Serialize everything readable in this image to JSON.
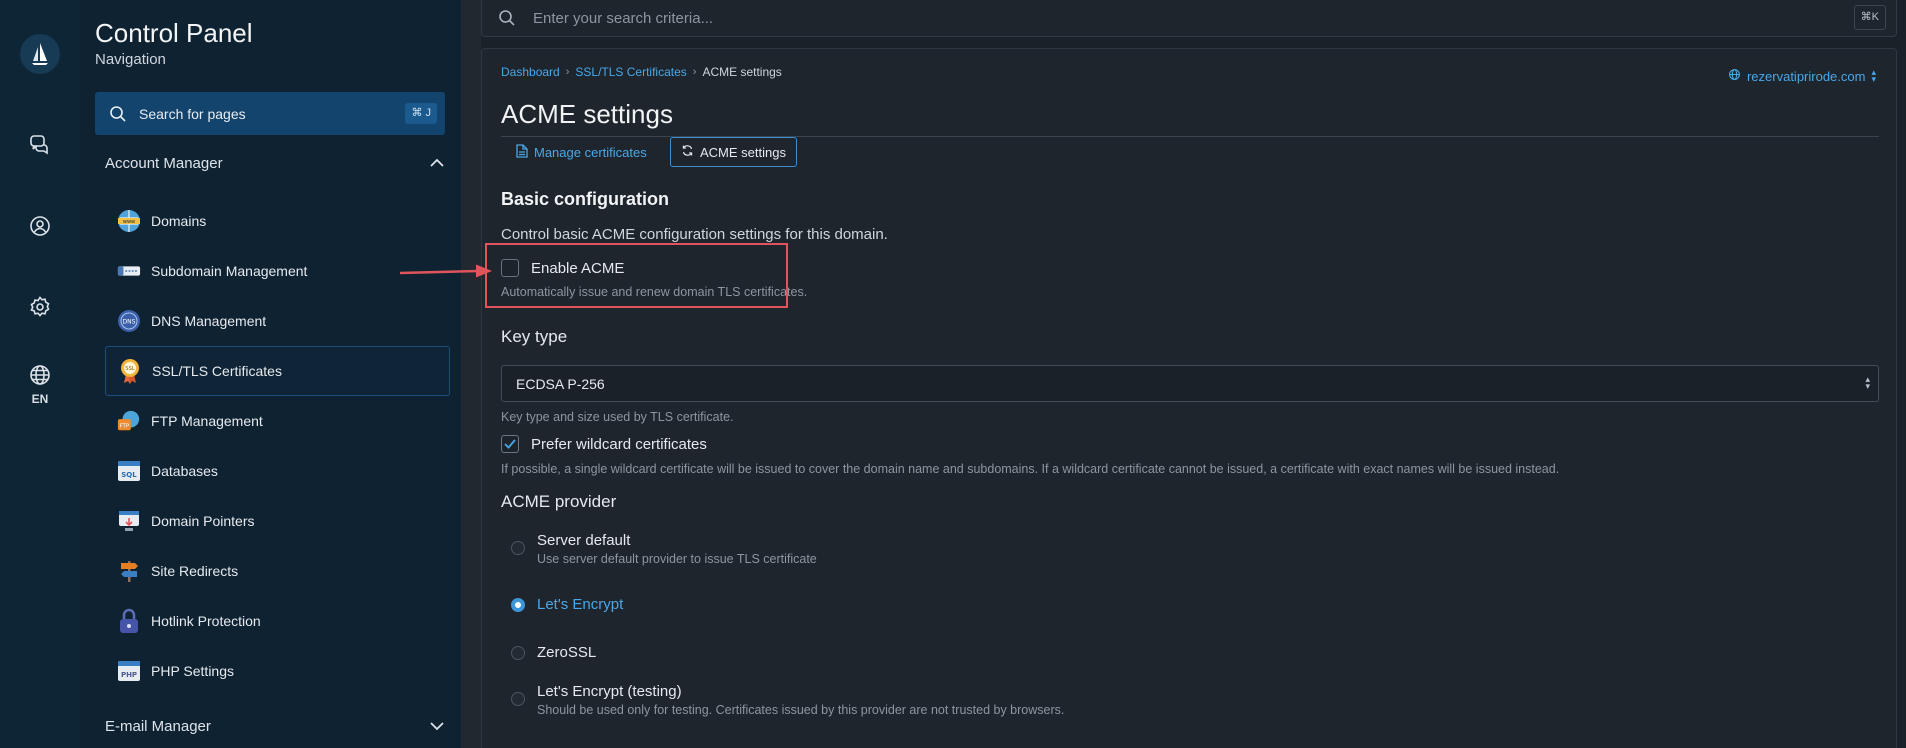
{
  "rail": {
    "lang": "EN"
  },
  "sidebar": {
    "title": "Control Panel",
    "subtitle": "Navigation",
    "search_label": "Search for pages",
    "search_kbd": "⌘ J",
    "group1": "Account Manager",
    "items": [
      {
        "label": "Domains",
        "icon": "domains-icon"
      },
      {
        "label": "Subdomain Management",
        "icon": "subdomain-icon"
      },
      {
        "label": "DNS Management",
        "icon": "dns-icon"
      },
      {
        "label": "SSL/TLS Certificates",
        "icon": "ssl-certificate-icon"
      },
      {
        "label": "FTP Management",
        "icon": "ftp-icon"
      },
      {
        "label": "Databases",
        "icon": "database-icon"
      },
      {
        "label": "Domain Pointers",
        "icon": "domain-pointers-icon"
      },
      {
        "label": "Site Redirects",
        "icon": "redirect-icon"
      },
      {
        "label": "Hotlink Protection",
        "icon": "lock-icon"
      },
      {
        "label": "PHP Settings",
        "icon": "php-icon"
      }
    ],
    "group2": "E-mail Manager"
  },
  "topsearch": {
    "placeholder": "Enter your search criteria...",
    "kbd": "⌘K"
  },
  "breadcrumb": {
    "b1": "Dashboard",
    "b2": "SSL/TLS Certificates",
    "b3": "ACME settings"
  },
  "domain": "rezervatiprirode.com",
  "page_title": "ACME settings",
  "tabs": {
    "t1": "Manage certificates",
    "t2": "ACME settings"
  },
  "basic": {
    "heading": "Basic configuration",
    "desc": "Control basic ACME configuration settings for this domain.",
    "enable_label": "Enable ACME",
    "enable_checked": false,
    "enable_help": "Automatically issue and renew domain TLS certificates."
  },
  "keytype": {
    "label": "Key type",
    "value": "ECDSA P-256",
    "help": "Key type and size used by TLS certificate.",
    "wildcard_label": "Prefer wildcard certificates",
    "wildcard_checked": true,
    "wildcard_help": "If possible, a single wildcard certificate will be issued to cover the domain name and subdomains. If a wildcard certificate cannot be issued, a certificate with exact names will be issued instead."
  },
  "provider": {
    "label": "ACME provider",
    "options": [
      {
        "label": "Server default",
        "desc": "Use server default provider to issue TLS certificate",
        "selected": false
      },
      {
        "label": "Let's Encrypt",
        "desc": "",
        "selected": true
      },
      {
        "label": "ZeroSSL",
        "desc": "",
        "selected": false
      },
      {
        "label": "Let's Encrypt (testing)",
        "desc": "Should be used only for testing. Certificates issued by this provider are not trusted by browsers.",
        "selected": false
      }
    ]
  },
  "colors": {
    "accent": "#4aa8e8",
    "highlight": "#e0555b",
    "sidebar_bg": "#0f2232",
    "rail_bg": "#0e2535"
  }
}
